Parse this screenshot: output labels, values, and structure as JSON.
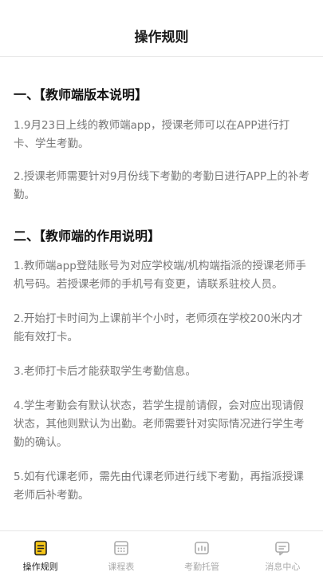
{
  "header": {
    "title": "操作规则"
  },
  "sections": [
    {
      "title": "一、【教师端版本说明】",
      "paragraphs": [
        "1.9月23日上线的教师端app，授课老师可以在APP进行打卡、学生考勤。",
        "2.授课老师需要针对9月份线下考勤的考勤日进行APP上的补考勤。"
      ]
    },
    {
      "title": "二、【教师端的作用说明】",
      "paragraphs": [
        "1.教师端app登陆账号为对应学校端/机构端指派的授课老师手机号码。若授课老师的手机号有变更，请联系驻校人员。",
        "2.开始打卡时间为上课前半个小时，老师须在学校200米内才能有效打卡。",
        "3.老师打卡后才能获取学生考勤信息。",
        "4.学生考勤会有默认状态，若学生提前请假，会对应出现请假状态，其他则默认为出勤。老师需要针对实际情况进行学生考勤的确认。",
        "5.如有代课老师，需先由代课老师进行线下考勤，再指派授课老师后补考勤。"
      ]
    }
  ],
  "tabbar": {
    "items": [
      {
        "label": "操作规则",
        "icon": "rules-icon",
        "active": true
      },
      {
        "label": "课程表",
        "icon": "calendar-icon",
        "active": false
      },
      {
        "label": "考勤托管",
        "icon": "attendance-icon",
        "active": false
      },
      {
        "label": "消息中心",
        "icon": "message-icon",
        "active": false
      }
    ]
  },
  "colors": {
    "active_icon_fill": "#f5c518",
    "active_text": "#222222",
    "inactive": "#aaaaaa",
    "body_text": "#777777",
    "heading_text": "#111111"
  }
}
